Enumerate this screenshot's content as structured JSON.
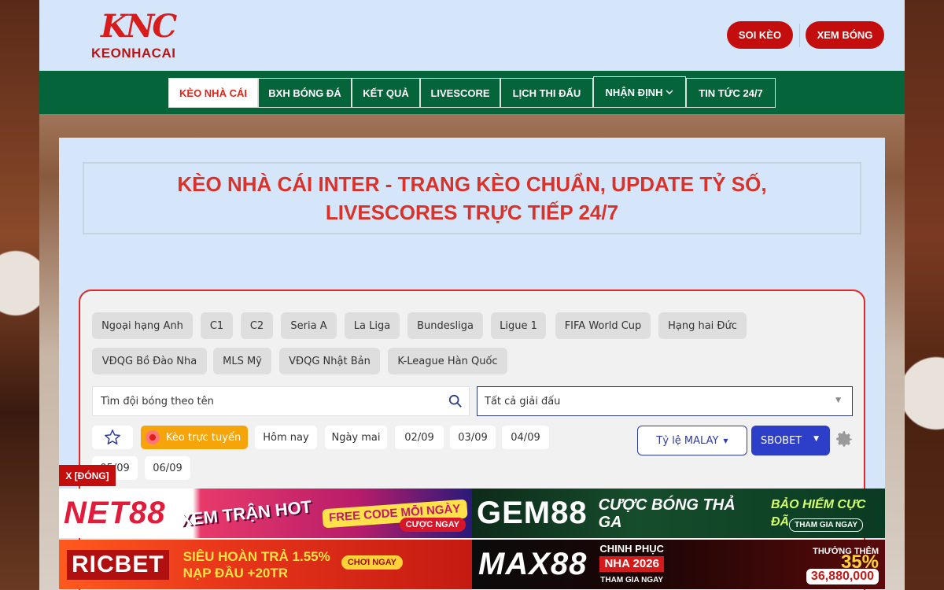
{
  "header": {
    "logo_mark": "KNC",
    "logo_text": "KEONHACAI",
    "buttons": [
      {
        "label": "SOI KÈO"
      },
      {
        "label": "XEM BÓNG"
      }
    ]
  },
  "nav": {
    "items": [
      {
        "label": "KÈO NHÀ CÁI"
      },
      {
        "label": "BXH BÓNG ĐÁ"
      },
      {
        "label": "KẾT QUẢ"
      },
      {
        "label": "LIVESCORE"
      },
      {
        "label": "LỊCH THI ĐẤU"
      },
      {
        "label": "NHẬN ĐỊNH"
      },
      {
        "label": "TIN TỨC 24/7"
      }
    ]
  },
  "main": {
    "title": "KÈO NHÀ CÁI INTER - TRANG KÈO CHUẨN, UPDATE TỶ SỐ, LIVESCORES TRỰC TIẾP 24/7"
  },
  "widget": {
    "leagues": [
      "Ngoại hạng Anh",
      "C1",
      "C2",
      "Seria A",
      "La Liga",
      "Bundesliga",
      "Ligue 1",
      "FIFA World Cup",
      "Hạng hai Đức",
      "VĐQG Bồ Đào Nha",
      "MLS Mỹ",
      "VĐQG Nhật Bản",
      "K-League Hàn Quốc"
    ],
    "search_placeholder": "Tìm đội bóng theo tên",
    "league_select": "Tất cả giải đấu",
    "live_label": "Kèo trực tuyến",
    "days": [
      "Hôm nay",
      "Ngày mai",
      "02/09",
      "03/09",
      "04/09",
      "05/09",
      "06/09"
    ],
    "odds_type": "Tỷ lệ MALAY",
    "bookie": "SBOBET"
  },
  "ads": {
    "close_label": "X [ĐÓNG]",
    "net88": {
      "brand": "NET88",
      "slogan": "XEM TRẬN HOT",
      "code": "FREE CODE MỖI NGÀY",
      "cta": "CƯỢC NGAY"
    },
    "gem88": {
      "brand": "GEM88",
      "slogan": "CƯỢC BÓNG THẢ GA",
      "slogan2": "BẢO HIỂM CỰC ĐÃ",
      "cta": "THAM GIA NGAY"
    },
    "ricbet": {
      "brand": "RICBET",
      "slogan": "SIÊU HOÀN TRẢ 1.55%",
      "slogan2": "NẠP ĐẦU +20TR",
      "cta": "CHƠI NGAY"
    },
    "max88": {
      "brand": "MAX88",
      "slogan": "CHINH PHỤC",
      "slogan2": "NHA 2026",
      "slogan3": "THAM GIA NGAY",
      "cta_top": "THƯỞNG THÊM",
      "cta_pct": "35%",
      "prize": "36,880,000"
    }
  },
  "colors": {
    "brand_red": "#c40d0d",
    "nav_green": "#05643a",
    "accent_blue": "#2d3fc9",
    "live_orange": "#f5a40a"
  }
}
